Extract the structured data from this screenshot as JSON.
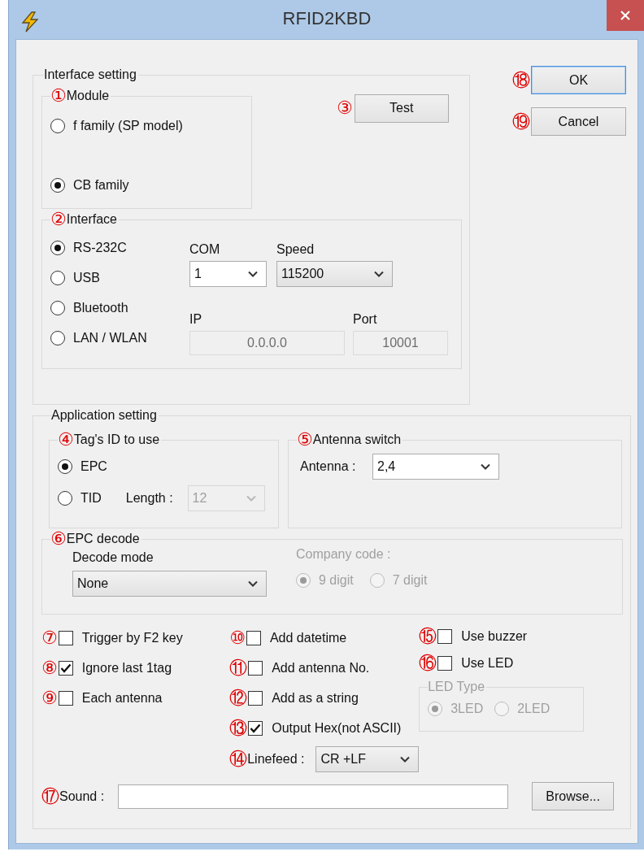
{
  "window": {
    "title": "RFID2KBD"
  },
  "buttons": [
    {
      "marker": "⑱",
      "label": "OK",
      "focused": true
    },
    {
      "marker": "⑲",
      "label": "Cancel",
      "focused": false
    }
  ],
  "interface_setting": {
    "title": "Interface setting",
    "module": {
      "marker": "①",
      "title": "Module",
      "options": [
        {
          "label": "f family (SP model)",
          "selected": false
        },
        {
          "label": "CB family",
          "selected": true
        }
      ]
    },
    "test_button": {
      "marker": "③",
      "label": "Test"
    },
    "interface": {
      "marker": "②",
      "title": "Interface",
      "options": [
        {
          "label": "RS-232C",
          "selected": true
        },
        {
          "label": "USB",
          "selected": false
        },
        {
          "label": "Bluetooth",
          "selected": false
        },
        {
          "label": "LAN / WLAN",
          "selected": false
        }
      ],
      "com": {
        "label": "COM",
        "value": "1",
        "kind": "editable",
        "disabled": false
      },
      "speed": {
        "label": "Speed",
        "value": "115200",
        "kind": "list",
        "disabled": false
      },
      "ip": {
        "label": "IP",
        "value": "0.0.0.0",
        "disabled": true
      },
      "port": {
        "label": "Port",
        "value": "10001",
        "disabled": true
      }
    }
  },
  "application_setting": {
    "title": "Application setting",
    "tag_id": {
      "marker": "④",
      "title": "Tag's ID to use",
      "options": [
        {
          "label": "EPC",
          "selected": true
        },
        {
          "label": "TID",
          "selected": false
        }
      ],
      "length": {
        "label": "Length :",
        "value": "12",
        "disabled": true
      }
    },
    "antenna_switch": {
      "marker": "⑤",
      "title": "Antenna switch",
      "antenna": {
        "label": "Antenna :",
        "value": "2,4",
        "kind": "editable",
        "disabled": false
      }
    },
    "epc_decode": {
      "marker": "⑥",
      "title": "EPC decode",
      "decode_mode": {
        "label": "Decode mode",
        "value": "None",
        "kind": "list",
        "disabled": false
      },
      "company_code": {
        "label": "Company code :",
        "disabled": true,
        "options": [
          {
            "label": "9 digit",
            "selected": true
          },
          {
            "label": "7 digit",
            "selected": false
          }
        ]
      }
    },
    "checkbox_columns": [
      [
        {
          "marker": "⑦",
          "label": "Trigger by F2 key",
          "checked": false
        },
        {
          "marker": "⑧",
          "label": "Ignore last 1tag",
          "checked": true
        },
        {
          "marker": "⑨",
          "label": "Each antenna",
          "checked": false
        }
      ],
      [
        {
          "marker": "⑩",
          "label": "Add datetime",
          "checked": false
        },
        {
          "marker": "⑪",
          "label": "Add antenna No.",
          "checked": false
        },
        {
          "marker": "⑫",
          "label": "Add as a string",
          "checked": false
        },
        {
          "marker": "⑬",
          "label": "Output Hex(not ASCII)",
          "checked": true
        }
      ],
      [
        {
          "marker": "⑮",
          "label": "Use buzzer",
          "checked": false
        },
        {
          "marker": "⑯",
          "label": "Use LED",
          "checked": false
        }
      ]
    ],
    "linefeed": {
      "marker": "⑭",
      "label": "Linefeed :",
      "value": "CR +LF",
      "kind": "list",
      "disabled": false
    },
    "led_type": {
      "title": "LED Type",
      "disabled": true,
      "options": [
        {
          "label": "3LED",
          "selected": true
        },
        {
          "label": "2LED",
          "selected": false
        }
      ]
    },
    "sound": {
      "marker": "⑰",
      "label": "Sound :"
    },
    "browse_button": {
      "label": "Browse..."
    }
  }
}
